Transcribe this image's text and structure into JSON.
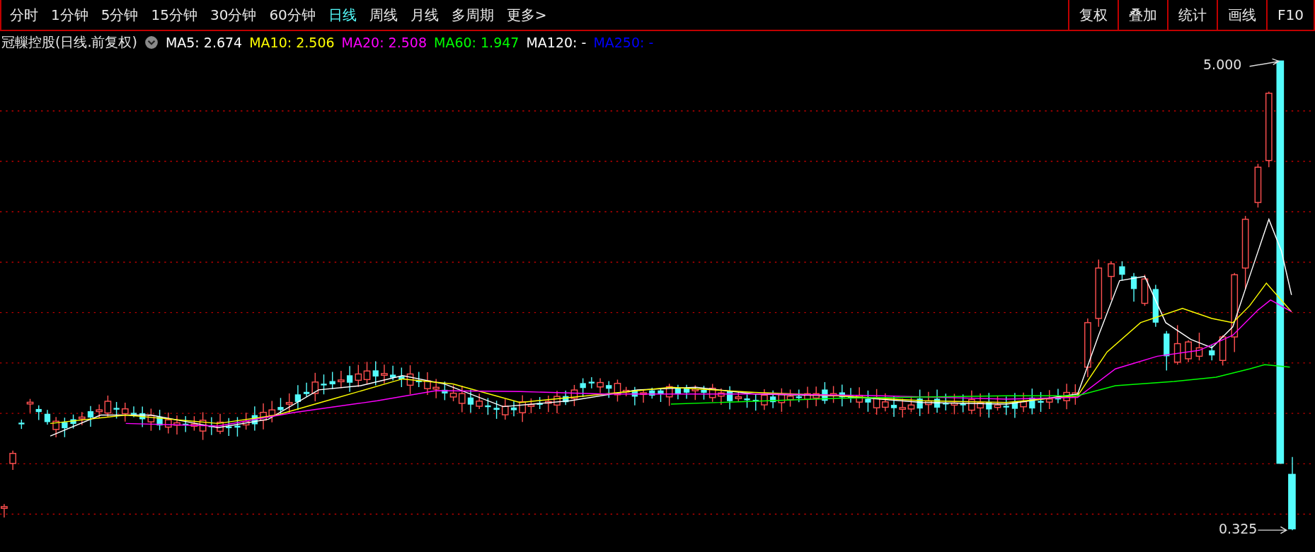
{
  "period_tabs": [
    {
      "label": "分时",
      "selected": false
    },
    {
      "label": "1分钟",
      "selected": false
    },
    {
      "label": "5分钟",
      "selected": false
    },
    {
      "label": "15分钟",
      "selected": false
    },
    {
      "label": "30分钟",
      "selected": false
    },
    {
      "label": "60分钟",
      "selected": false
    },
    {
      "label": "日线",
      "selected": true
    },
    {
      "label": "周线",
      "selected": false
    },
    {
      "label": "月线",
      "selected": false
    },
    {
      "label": "多周期",
      "selected": false
    },
    {
      "label": "更多>",
      "selected": false
    }
  ],
  "tool_buttons": [
    "复权",
    "叠加",
    "统计",
    "画线",
    "F10"
  ],
  "chart_title": "冠轈控股(日线.前复权)",
  "indicators": [
    {
      "text": "MA5: 2.674",
      "color": "#ffffff"
    },
    {
      "text": "MA10: 2.506",
      "color": "#ffff00"
    },
    {
      "text": "MA20: 2.508",
      "color": "#ff00ff"
    },
    {
      "text": "MA60: 1.947",
      "color": "#00ff00"
    },
    {
      "text": "MA120: -",
      "color": "#ffffff"
    },
    {
      "text": "MA250: -",
      "color": "#0000ff"
    }
  ],
  "price_high": "5.000",
  "price_low": "0.325"
}
